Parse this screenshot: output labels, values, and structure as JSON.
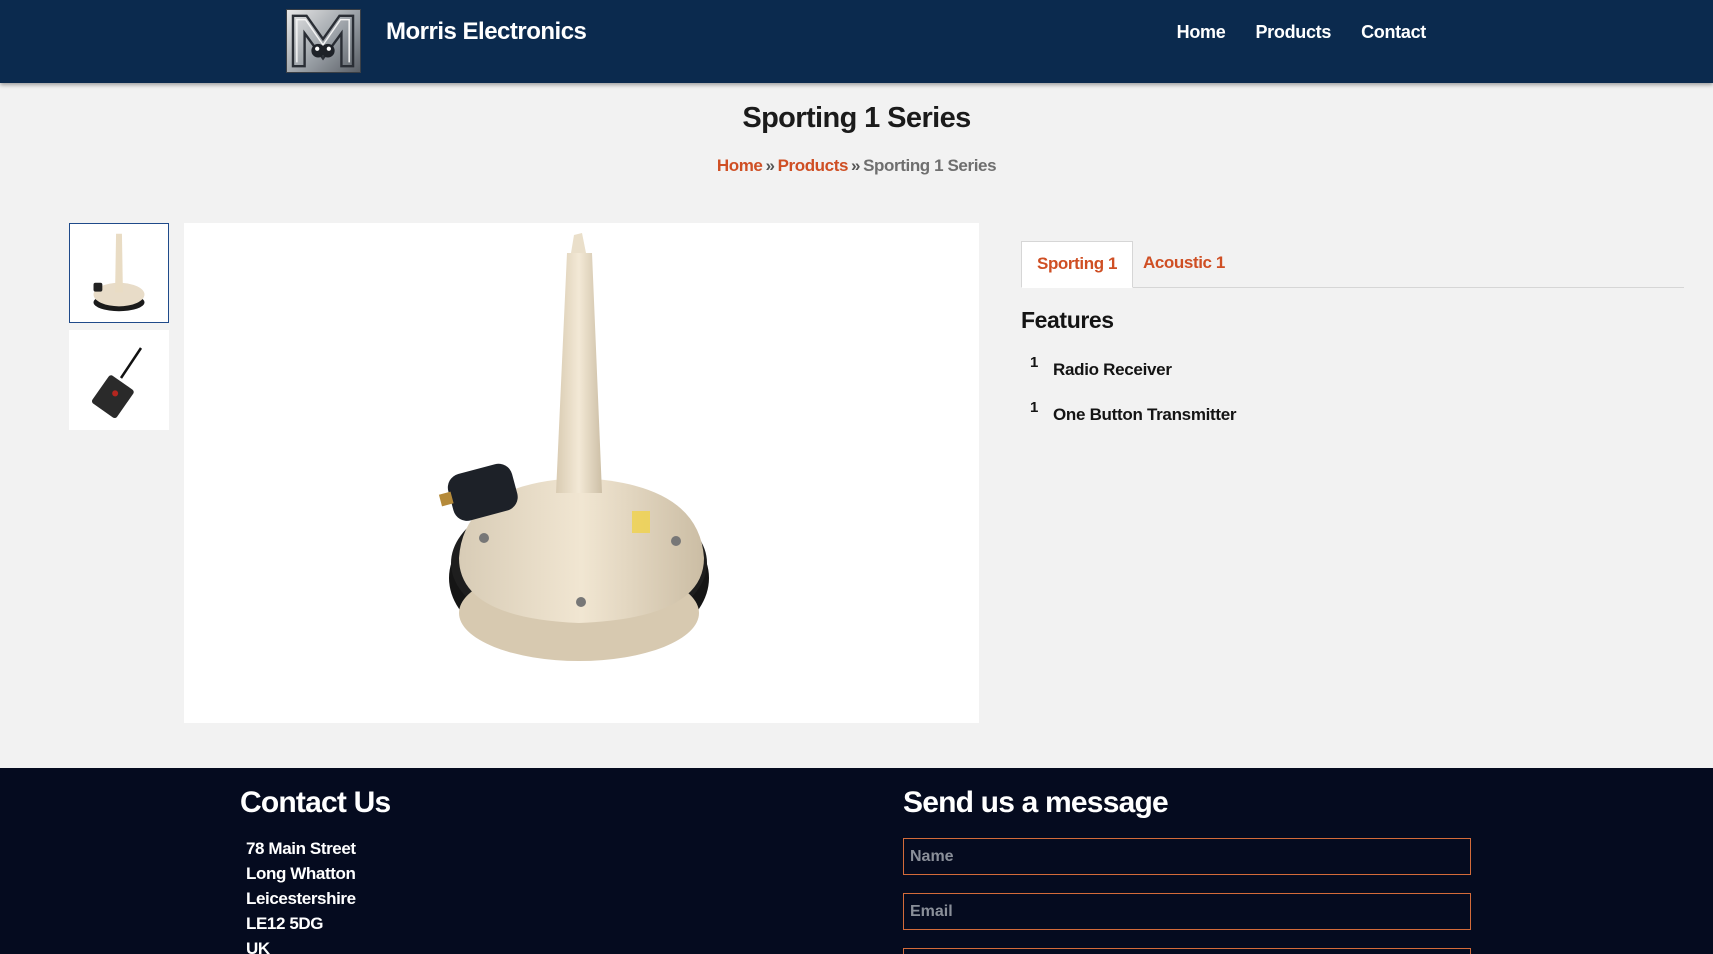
{
  "header": {
    "brand": "Morris Electronics",
    "nav": [
      "Home",
      "Products",
      "Contact"
    ]
  },
  "page": {
    "title": "Sporting 1 Series",
    "breadcrumb": {
      "home": "Home",
      "separator": "»",
      "products": "Products",
      "current": "Sporting 1 Series"
    }
  },
  "tabs": [
    "Sporting 1",
    "Acoustic 1"
  ],
  "features": {
    "title": "Features",
    "items": [
      {
        "qty": "1",
        "name": "Radio Receiver"
      },
      {
        "qty": "1",
        "name": "One Button Transmitter"
      }
    ]
  },
  "footer": {
    "contact_title": "Contact Us",
    "address": [
      "78 Main Street",
      "Long Whatton",
      "Leicestershire",
      "LE12 5DG",
      "UK"
    ],
    "message_title": "Send us a message",
    "name_placeholder": "Name",
    "email_placeholder": "Email"
  },
  "colors": {
    "header_bg": "#0b2a4e",
    "accent": "#cf4f24",
    "footer_bg": "#050b1f"
  }
}
